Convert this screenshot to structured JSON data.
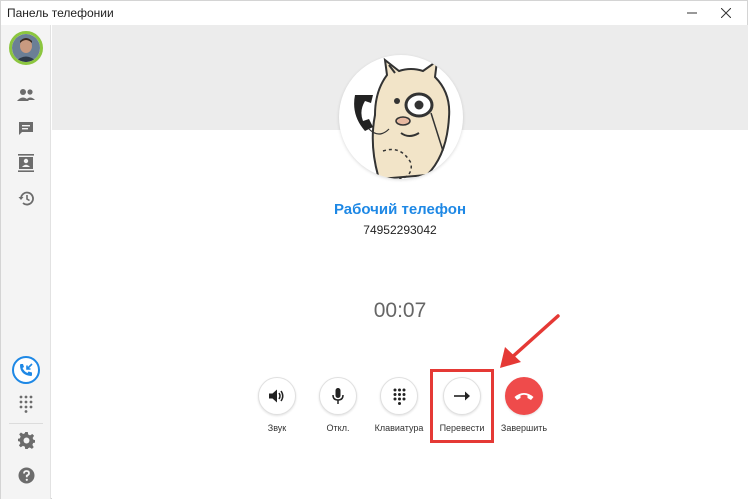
{
  "window": {
    "title": "Панель телефонии"
  },
  "call": {
    "contact_name": "Рабочий телефон",
    "phone_number": "74952293042",
    "duration": "00:07"
  },
  "controls": {
    "sound": "Звук",
    "mute": "Откл.",
    "keypad": "Клавиатура",
    "transfer": "Перевести",
    "hangup": "Завершить"
  },
  "colors": {
    "accent": "#1e88e5",
    "hangup": "#ef4b4b",
    "avatar_ring": "#8cc63f",
    "annotation": "#e53935"
  }
}
